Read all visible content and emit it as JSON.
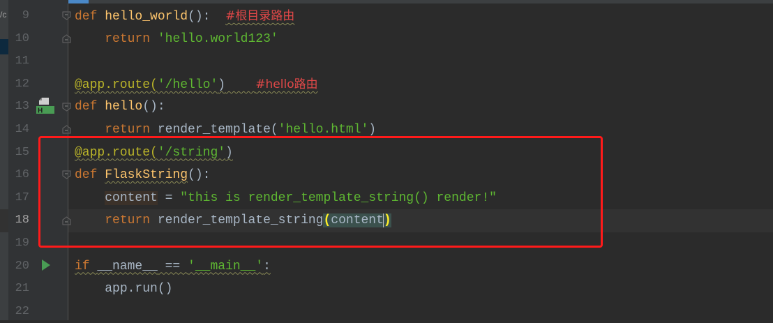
{
  "editor": {
    "left_panel_fragment": "/c",
    "current_line": "18",
    "lines": [
      {
        "num": "9",
        "tokens": [
          [
            "def ",
            "kw"
          ],
          [
            "hello_world",
            "fn"
          ],
          [
            "():  ",
            "df"
          ],
          [
            "#根目录路由",
            "cm wavy"
          ]
        ]
      },
      {
        "num": "10",
        "tokens": [
          [
            "    ",
            ""
          ],
          [
            "return ",
            "kw"
          ],
          [
            "'hello.world123'",
            "str"
          ]
        ]
      },
      {
        "num": "11",
        "tokens": []
      },
      {
        "num": "12",
        "tokens": [
          [
            "@app.route(",
            "dec wavy"
          ],
          [
            "'/hello'",
            "str wavy"
          ],
          [
            ")",
            "df wavy"
          ],
          [
            "    ",
            "wavy"
          ],
          [
            "#hello路由",
            "cm wavy"
          ]
        ]
      },
      {
        "num": "13",
        "tokens": [
          [
            "def ",
            "kw"
          ],
          [
            "hello",
            "fn"
          ],
          [
            "():",
            "df"
          ]
        ]
      },
      {
        "num": "14",
        "tokens": [
          [
            "    ",
            ""
          ],
          [
            "return ",
            "kw"
          ],
          [
            "render_template(",
            "df"
          ],
          [
            "'hello.html'",
            "str"
          ],
          [
            ")",
            "df"
          ]
        ]
      },
      {
        "num": "15",
        "tokens": [
          [
            "@app.route(",
            "dec wavy"
          ],
          [
            "'/string'",
            "str wavy"
          ],
          [
            ")",
            "df wavy"
          ]
        ]
      },
      {
        "num": "16",
        "tokens": [
          [
            "def ",
            "kw"
          ],
          [
            "FlaskString",
            "fn wavy"
          ],
          [
            "():",
            "df"
          ]
        ]
      },
      {
        "num": "17",
        "tokens": [
          [
            "    ",
            ""
          ],
          [
            "content",
            "df varbg"
          ],
          [
            " = ",
            "df"
          ],
          [
            "\"this is render_template_string() render!\"",
            "str"
          ]
        ]
      },
      {
        "num": "18",
        "tokens": [
          [
            "    ",
            ""
          ],
          [
            "return ",
            "kw"
          ],
          [
            "render_template_string",
            "df"
          ],
          [
            "(",
            "brk"
          ],
          [
            "content",
            "df brkc"
          ],
          [
            "|caret",
            ""
          ],
          [
            ")",
            "brk"
          ]
        ]
      },
      {
        "num": "19",
        "tokens": []
      },
      {
        "num": "20",
        "tokens": [
          [
            "if ",
            "kw wavy"
          ],
          [
            "__name__",
            "df wavy"
          ],
          [
            " == ",
            "df wavy"
          ],
          [
            "'__main__'",
            "str wavy"
          ],
          [
            ":",
            "df wavy"
          ]
        ]
      },
      {
        "num": "21",
        "tokens": [
          [
            "    ",
            ""
          ],
          [
            "app.run()",
            "df"
          ]
        ]
      },
      {
        "num": "22",
        "tokens": []
      }
    ],
    "fold_markers": {
      "9": "start",
      "10": "end",
      "13": "start",
      "14": "end",
      "16": "start",
      "18": "end"
    },
    "gutter_icons": {
      "13": "html-template-icon",
      "20": "run-icon"
    },
    "highlight_box_color": "#ff1a1a"
  }
}
